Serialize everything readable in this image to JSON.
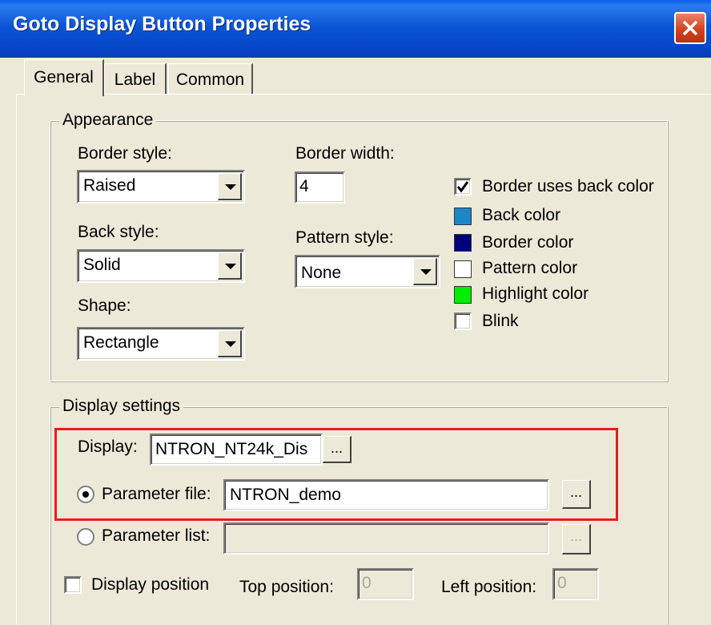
{
  "window": {
    "title": "Goto Display Button Properties"
  },
  "tabs": [
    {
      "label": "General"
    },
    {
      "label": "Label"
    },
    {
      "label": "Common"
    }
  ],
  "appearance": {
    "group_label": "Appearance",
    "border_style": {
      "label": "Border style:",
      "value": "Raised"
    },
    "back_style": {
      "label": "Back style:",
      "value": "Solid"
    },
    "shape": {
      "label": "Shape:",
      "value": "Rectangle"
    },
    "border_width": {
      "label": "Border width:",
      "value": "4"
    },
    "pattern_style": {
      "label": "Pattern style:",
      "value": "None"
    },
    "border_uses_back_color": {
      "label": "Border uses back color",
      "checked": true
    },
    "colors": [
      {
        "label": "Back color",
        "color": "#1c86c8"
      },
      {
        "label": "Border color",
        "color": "#00007f"
      },
      {
        "label": "Pattern color",
        "color": "#ffffff"
      },
      {
        "label": "Highlight color",
        "color": "#00ee00"
      }
    ],
    "blink": {
      "label": "Blink",
      "checked": false
    }
  },
  "display_settings": {
    "group_label": "Display settings",
    "display": {
      "label": "Display:",
      "value": "NTRON_NT24k_Dis",
      "browse_label": "..."
    },
    "parameter_file": {
      "label": "Parameter file:",
      "value": "NTRON_demo",
      "browse_label": "...",
      "selected": true
    },
    "parameter_list": {
      "label": "Parameter list:",
      "value": "",
      "browse_label": "...",
      "selected": false
    },
    "display_position": {
      "label": "Display position",
      "checked": false
    },
    "top_position": {
      "label": "Top position:",
      "value": "0"
    },
    "left_position": {
      "label": "Left position:",
      "value": "0"
    }
  },
  "colors": {
    "highlight_box": "#e02020",
    "title_bar": "#0546c8"
  }
}
